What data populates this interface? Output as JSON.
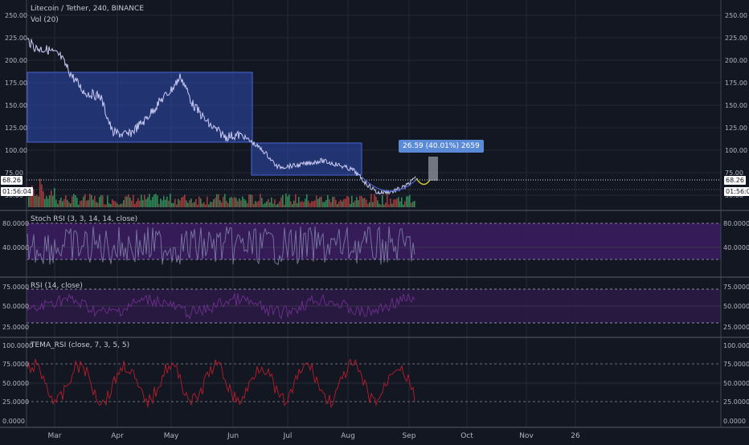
{
  "header": {
    "symbol_line": "Litecoin / Tether, 240, BINANCE",
    "vol_label": "Vol (20)"
  },
  "colors": {
    "background": "#131722",
    "grid": "#242833",
    "price_line": "#c9cbf2",
    "rect_fill": "#2f4ab5",
    "stoch_band": "#3a1d5e",
    "rsi_band": "#2b1a45",
    "tema_line": "#b81d2a",
    "rsi_line": "#6e2f8e",
    "stoch_line": "#7a79a3",
    "volume_up": "#2e8b57",
    "volume_down": "#a33a3a",
    "projection": "#d8cc38",
    "target_box": "#8a8e9a",
    "tooltip": "#5b8ad6"
  },
  "price_axis": {
    "ticks": [
      "250.00",
      "225.00",
      "200.00",
      "175.00",
      "150.00",
      "125.00",
      "100.00",
      "75.00",
      "50.00"
    ],
    "last_price": "68.26",
    "countdown": "01:56:04"
  },
  "stoch_panel": {
    "title": "Stoch RSI (3, 3, 14, 14, close)",
    "ticks": [
      "80.0000",
      "40.0000"
    ]
  },
  "rsi_panel": {
    "title": "RSI (14, close)",
    "ticks": [
      "75.0000",
      "50.0000",
      "25.0000"
    ]
  },
  "tema_panel": {
    "title": "TEMA_RSI (close, 7, 3, 5, 5)",
    "ticks": [
      "100.0000",
      "75.0000",
      "50.0000",
      "25.0000",
      "0.0000"
    ]
  },
  "time_axis": {
    "labels": [
      "Mar",
      "Apr",
      "May",
      "Jun",
      "Jul",
      "Aug",
      "Sep",
      "Oct",
      "Nov",
      "26"
    ]
  },
  "measure_tooltip": "26.59 (40.01%) 2659",
  "chart_data": {
    "type": "line",
    "title": "Litecoin / Tether, 240, BINANCE",
    "ylim": [
      40,
      260
    ],
    "x": [
      "Mar",
      "Apr",
      "May",
      "Jun",
      "Jul",
      "Aug",
      "Sep"
    ],
    "series": [
      {
        "values": [
          228,
          182,
          110,
          182,
          108,
          76,
          70,
          48,
          68
        ]
      }
    ]
  }
}
